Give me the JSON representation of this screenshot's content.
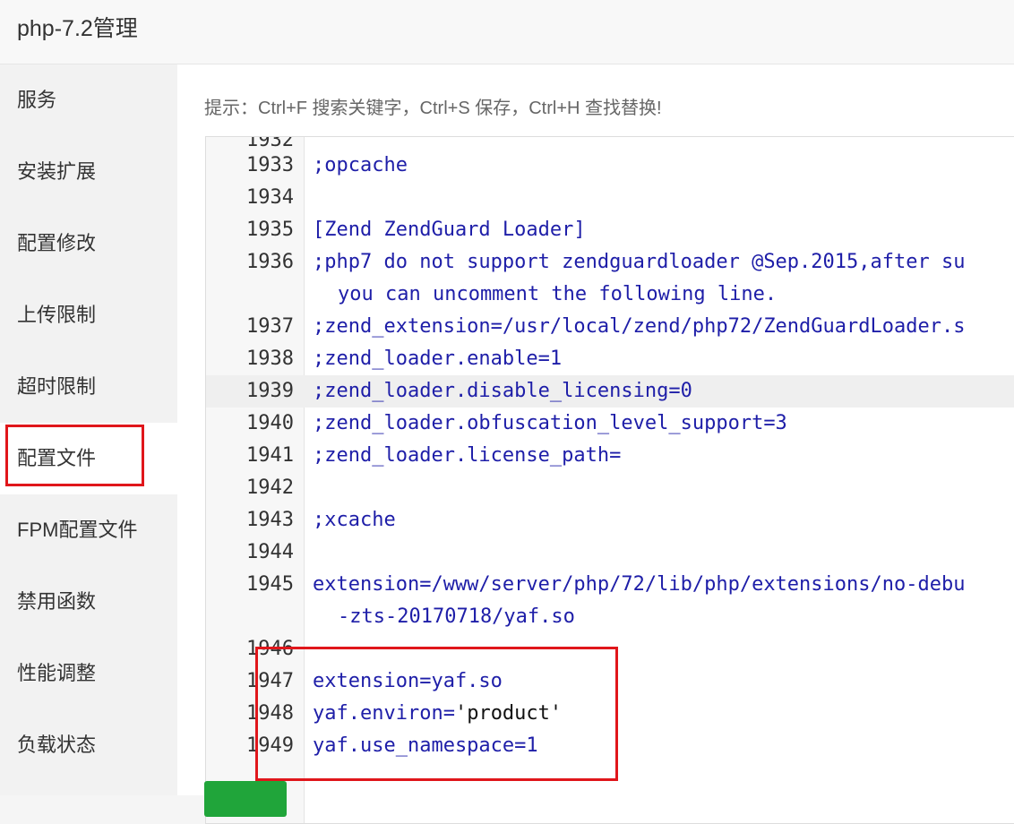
{
  "window": {
    "title": "php-7.2管理"
  },
  "sidebar": {
    "items": [
      {
        "label": "服务"
      },
      {
        "label": "安装扩展"
      },
      {
        "label": "配置修改"
      },
      {
        "label": "上传限制"
      },
      {
        "label": "超时限制"
      },
      {
        "label": "配置文件",
        "active": true
      },
      {
        "label": "FPM配置文件"
      },
      {
        "label": "禁用函数"
      },
      {
        "label": "性能调整"
      },
      {
        "label": "负载状态"
      }
    ]
  },
  "editor": {
    "hint": "提示：Ctrl+F 搜索关键字，Ctrl+S 保存，Ctrl+H 查找替换!",
    "partial_top_line": "1932",
    "lines": [
      {
        "n": "1933",
        "text": ";opcache"
      },
      {
        "n": "1934",
        "text": ""
      },
      {
        "n": "1935",
        "text": "[Zend ZendGuard Loader]"
      },
      {
        "n": "1936",
        "text": ";php7 do not support zendguardloader @Sep.2015,after su",
        "cont": "you can uncomment the following line."
      },
      {
        "n": "1937",
        "text": ";zend_extension=/usr/local/zend/php72/ZendGuardLoader.s"
      },
      {
        "n": "1938",
        "text": ";zend_loader.enable=1"
      },
      {
        "n": "1939",
        "text": ";zend_loader.disable_licensing=0",
        "active": true
      },
      {
        "n": "1940",
        "text": ";zend_loader.obfuscation_level_support=3"
      },
      {
        "n": "1941",
        "text": ";zend_loader.license_path="
      },
      {
        "n": "1942",
        "text": ""
      },
      {
        "n": "1943",
        "text": ";xcache"
      },
      {
        "n": "1944",
        "text": ""
      },
      {
        "n": "1945",
        "text": "extension=/www/server/php/72/lib/php/extensions/no-debu",
        "cont": "-zts-20170718/yaf.so"
      },
      {
        "n": "1946",
        "text": ""
      },
      {
        "n": "1947",
        "text": "extension=yaf.so"
      },
      {
        "n": "1948",
        "text_prefix": "yaf.environ=",
        "text_string": "'product'"
      },
      {
        "n": "1949",
        "text": "yaf.use_namespace=1"
      }
    ]
  },
  "colors": {
    "keyword": "#1e1ea8",
    "string": "#111111",
    "save_button": "#20a53a",
    "annotation": "#e0161b"
  }
}
